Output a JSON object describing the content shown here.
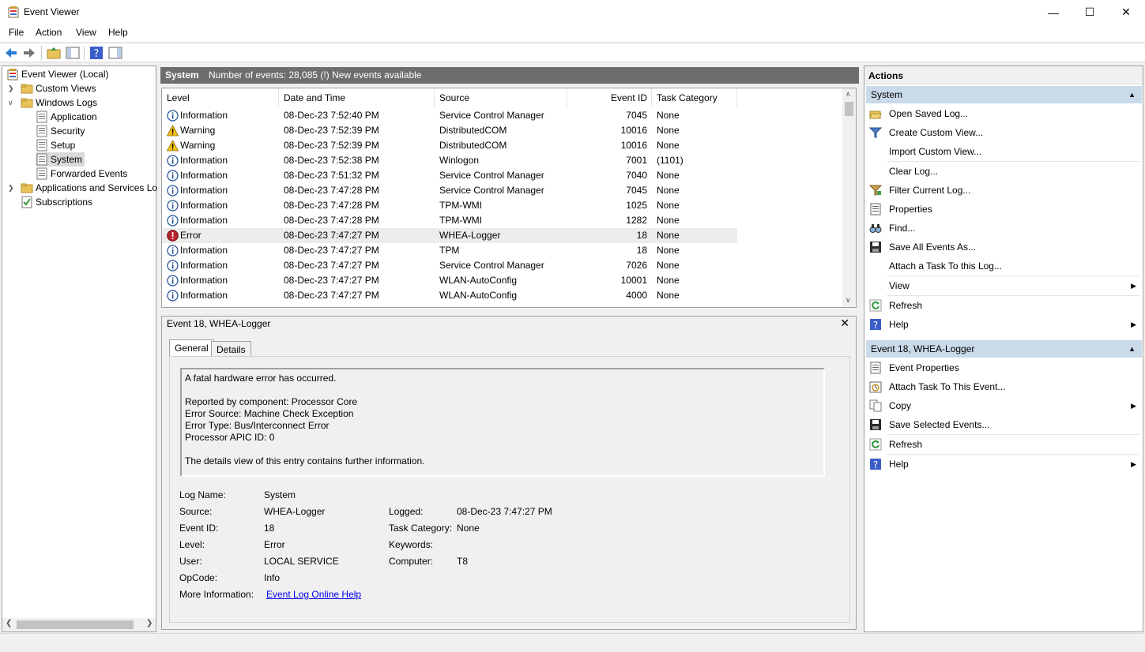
{
  "window": {
    "title": "Event Viewer",
    "minimize": "—",
    "maximize": "☐",
    "close": "✕"
  },
  "menu": [
    "File",
    "Action",
    "View",
    "Help"
  ],
  "tree": {
    "root": "Event Viewer (Local)",
    "custom_views": "Custom Views",
    "windows_logs": "Windows Logs",
    "logs": [
      "Application",
      "Security",
      "Setup",
      "System",
      "Forwarded Events"
    ],
    "apps_services": "Applications and Services Lo",
    "subscriptions": "Subscriptions"
  },
  "center": {
    "log_name": "System",
    "summary": "Number of events: 28,085 (!) New events available",
    "columns": [
      "Level",
      "Date and Time",
      "Source",
      "Event ID",
      "Task Category"
    ],
    "rows": [
      {
        "level": "Information",
        "icon": "info-icon",
        "date": "08-Dec-23 7:52:40 PM",
        "source": "Service Control Manager",
        "id": "7045",
        "task": "None"
      },
      {
        "level": "Warning",
        "icon": "warning-icon",
        "date": "08-Dec-23 7:52:39 PM",
        "source": "DistributedCOM",
        "id": "10016",
        "task": "None"
      },
      {
        "level": "Warning",
        "icon": "warning-icon",
        "date": "08-Dec-23 7:52:39 PM",
        "source": "DistributedCOM",
        "id": "10016",
        "task": "None"
      },
      {
        "level": "Information",
        "icon": "info-icon",
        "date": "08-Dec-23 7:52:38 PM",
        "source": "Winlogon",
        "id": "7001",
        "task": "(1101)"
      },
      {
        "level": "Information",
        "icon": "info-icon",
        "date": "08-Dec-23 7:51:32 PM",
        "source": "Service Control Manager",
        "id": "7040",
        "task": "None"
      },
      {
        "level": "Information",
        "icon": "info-icon",
        "date": "08-Dec-23 7:47:28 PM",
        "source": "Service Control Manager",
        "id": "7045",
        "task": "None"
      },
      {
        "level": "Information",
        "icon": "info-icon",
        "date": "08-Dec-23 7:47:28 PM",
        "source": "TPM-WMI",
        "id": "1025",
        "task": "None"
      },
      {
        "level": "Information",
        "icon": "info-icon",
        "date": "08-Dec-23 7:47:28 PM",
        "source": "TPM-WMI",
        "id": "1282",
        "task": "None"
      },
      {
        "level": "Error",
        "icon": "error-icon",
        "date": "08-Dec-23 7:47:27 PM",
        "source": "WHEA-Logger",
        "id": "18",
        "task": "None"
      },
      {
        "level": "Information",
        "icon": "info-icon",
        "date": "08-Dec-23 7:47:27 PM",
        "source": "TPM",
        "id": "18",
        "task": "None"
      },
      {
        "level": "Information",
        "icon": "info-icon",
        "date": "08-Dec-23 7:47:27 PM",
        "source": "Service Control Manager",
        "id": "7026",
        "task": "None"
      },
      {
        "level": "Information",
        "icon": "info-icon",
        "date": "08-Dec-23 7:47:27 PM",
        "source": "WLAN-AutoConfig",
        "id": "10001",
        "task": "None"
      },
      {
        "level": "Information",
        "icon": "info-icon",
        "date": "08-Dec-23 7:47:27 PM",
        "source": "WLAN-AutoConfig",
        "id": "4000",
        "task": "None"
      }
    ]
  },
  "detail": {
    "title": "Event 18, WHEA-Logger",
    "tabs": [
      "General",
      "Details"
    ],
    "description": [
      "A fatal hardware error has occurred.",
      "Reported by component: Processor Core",
      "Error Source: Machine Check Exception",
      "Error Type: Bus/Interconnect Error",
      "Processor APIC ID: 0",
      "The details view of this entry contains further information."
    ],
    "props": {
      "log_name_label": "Log Name:",
      "log_name": "System",
      "source_label": "Source:",
      "source": "WHEA-Logger",
      "logged_label": "Logged:",
      "logged": "08-Dec-23 7:47:27 PM",
      "event_id_label": "Event ID:",
      "event_id": "18",
      "task_label": "Task Category:",
      "task": "None",
      "level_label": "Level:",
      "level": "Error",
      "keywords_label": "Keywords:",
      "keywords": "",
      "user_label": "User:",
      "user": "LOCAL SERVICE",
      "computer_label": "Computer:",
      "computer": "T8",
      "opcode_label": "OpCode:",
      "opcode": "Info",
      "more_info_label": "More Information:",
      "more_info_link": "Event Log Online Help"
    }
  },
  "actions": {
    "title": "Actions",
    "section1": "System",
    "items1": [
      "Open Saved Log...",
      "Create Custom View...",
      "Import Custom View...",
      "Clear Log...",
      "Filter Current Log...",
      "Properties",
      "Find...",
      "Save All Events As...",
      "Attach a Task To this Log...",
      "View",
      "Refresh",
      "Help"
    ],
    "section2": "Event 18, WHEA-Logger",
    "items2": [
      "Event Properties",
      "Attach Task To This Event...",
      "Copy",
      "Save Selected Events...",
      "Refresh",
      "Help"
    ]
  }
}
